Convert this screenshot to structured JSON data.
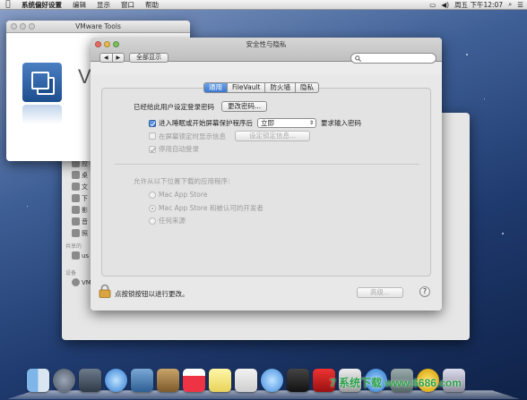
{
  "menubar": {
    "app": "系统偏好设置",
    "items": [
      "编辑",
      "显示",
      "窗口",
      "帮助"
    ],
    "clock": "周五 下午12:07"
  },
  "vmware_window": {
    "title": "VMware Tools",
    "big_text": "V"
  },
  "back_window": {
    "sidebar": [
      "应",
      "桌",
      "文",
      "下",
      "影",
      "音",
      "照"
    ],
    "shared_header": "共享的",
    "shared_item": "us",
    "devices_header": "设备",
    "device_item": "VM"
  },
  "main_window": {
    "title": "安全性与隐私",
    "nav_back": "◀",
    "nav_forward": "▶",
    "show_all": "全部显示",
    "search_placeholder": "",
    "tabs": [
      {
        "label": "通用",
        "active": true
      },
      {
        "label": "FileVault",
        "active": false
      },
      {
        "label": "防火墙",
        "active": false
      },
      {
        "label": "隐私",
        "active": false
      }
    ],
    "general": {
      "password_set_label": "已经给此用户设定登录密码",
      "change_password_button": "更改密码...",
      "require_password_label": "进入睡眠或开始屏幕保护程序后",
      "require_password_checked": true,
      "require_password_select": "立即",
      "require_password_suffix": "要求输入密码",
      "lock_message_label": "在屏幕锁定时显示信息",
      "lock_message_checked": false,
      "set_lock_message_button": "设定锁定信息...",
      "disable_autologin_label": "停用自动登录",
      "disable_autologin_checked": true,
      "download_header": "允许从以下位置下载的应用程序:",
      "download_options": [
        "Mac App Store",
        "Mac App Store 和被认可的开发者",
        "任何来源"
      ],
      "download_selected_index": 1
    },
    "lock_text": "点按锁按钮以进行更改。",
    "advanced_button": "高级...",
    "help_button": "?"
  },
  "watermark": "7 系统下载 www.6686.com",
  "colors": {
    "accent": "#3a77cf",
    "desktop": "#1f3a6e"
  }
}
